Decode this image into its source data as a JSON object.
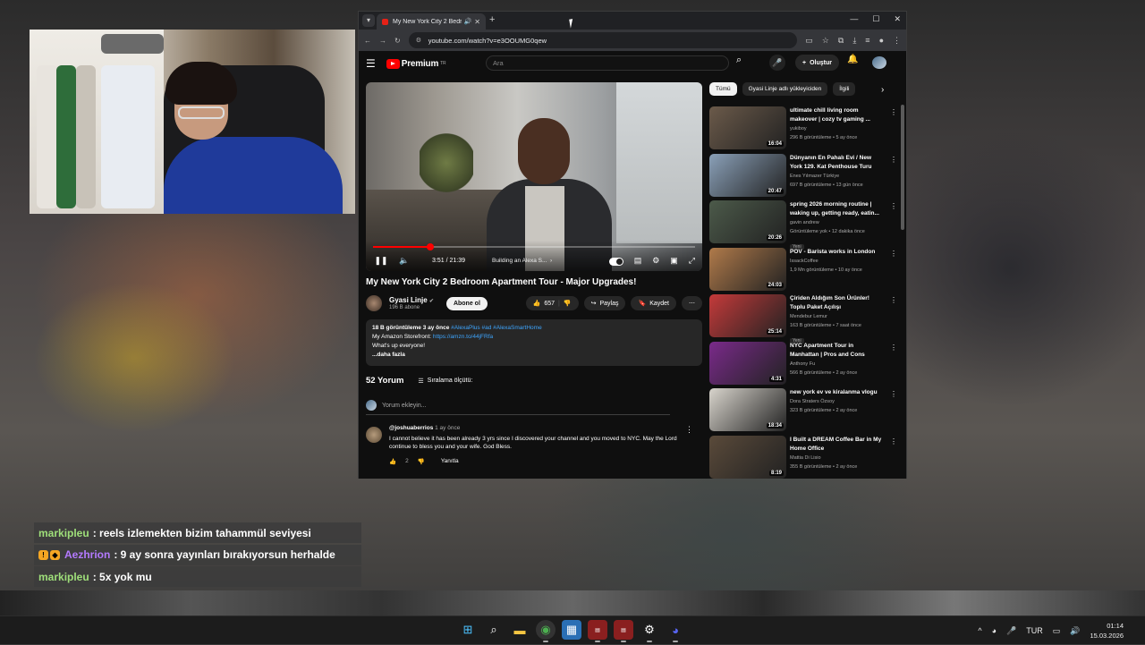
{
  "browser": {
    "tab_title": "My New York City 2 Bedroo",
    "url": "youtube.com/watch?v=e3OOUMG0qew"
  },
  "yt": {
    "search_placeholder": "Ara",
    "create_label": "Oluştur",
    "logo_text": "Premium",
    "logo_sup": "TR",
    "player": {
      "time": "3:51 / 21:39",
      "chapter": "Building an Alexa S...",
      "progress_fraction": 0.178
    },
    "video_title": "My New York City 2 Bedroom Apartment Tour - Major Upgrades!",
    "channel": {
      "name": "Gyasi Linje",
      "subs": "196 B abone"
    },
    "subscribe_label": "Abone ol",
    "likes": "657",
    "share_label": "Paylaş",
    "save_label": "Kaydet",
    "desc": {
      "meta": "18 B görüntüleme  3 ay önce",
      "tags": "#AlexaPlus #ad #AlexaSmartHome",
      "line1_prefix": "My Amazon Storefront: ",
      "line1_link": "https://amzn.to/44jFRfa",
      "line2": "What's up everyone!",
      "more": "...daha fazla"
    },
    "comments": {
      "count": "52 Yorum",
      "sort": "Sıralama ölçütü:",
      "add_placeholder": "Yorum ekleyin...",
      "first": {
        "author": "@joshuaberrios",
        "age": "1 ay önce",
        "text": "I cannot believe it has been already 3 yrs since I discovered your channel and you moved to NYC. May the Lord continue to bless you and your wife. God Bless.",
        "likes": "2",
        "reply": "Yanıtla"
      }
    },
    "chips": [
      "Tümü",
      "Gyasi Linje adlı yükleyiciden",
      "İlgili"
    ],
    "recs": [
      {
        "title": "ultimate chill living room makeover | cozy tv gaming ...",
        "channel": "yukiboy",
        "meta": "296 B görüntüleme • 5 ay önce",
        "dur": "16:04",
        "badge": "",
        "color": "#6b5a4a"
      },
      {
        "title": "Dünyanın En Pahalı Evi / New York 129. Kat Penthouse Turu",
        "channel": "Enes Yılmazer Türkiye",
        "meta": "697 B görüntüleme • 13 gün önce",
        "dur": "20:47",
        "badge": "",
        "color": "#8aa0b8"
      },
      {
        "title": "spring 2026 morning routine | waking up, getting ready, eatin...",
        "channel": "gavin andrew",
        "meta": "Görüntüleme yok • 12 dakika önce",
        "dur": "20:26",
        "badge": "Yeni",
        "color": "#4c5a4a"
      },
      {
        "title": "POV - Barista works in London",
        "channel": "IssackCoffee",
        "meta": "1,9 Mn görüntüleme • 10 ay önce",
        "dur": "24:03",
        "badge": "",
        "color": "#b07a4a"
      },
      {
        "title": "Çiriden Aldığım Son Ürünler! Toplu Paket Açılışı",
        "channel": "Mendebur Lemur",
        "meta": "163 B görüntüleme • 7 saat önce",
        "dur": "25:14",
        "badge": "Yeni",
        "color": "#c43a3a"
      },
      {
        "title": "NYC Apartment Tour in Manhattan | Pros and Cons",
        "channel": "Anthony Fu",
        "meta": "566 B görüntüleme • 2 ay önce",
        "dur": "4:31",
        "badge": "",
        "color": "#7a2a8a"
      },
      {
        "title": "new york ev ve kiralanma vlogu",
        "channel": "Dora Straters Özsoy",
        "meta": "323 B görüntüleme • 2 ay önce",
        "dur": "18:34",
        "badge": "",
        "color": "#d8d4cc"
      },
      {
        "title": "I Built a DREAM Coffee Bar in My Home Office",
        "channel": "Mattia Di Lisio",
        "meta": "355 B görüntüleme • 2 ay önce",
        "dur": "8:19",
        "badge": "",
        "color": "#5a4a3a"
      }
    ]
  },
  "chat": [
    {
      "user": "markipleu",
      "color": "#9fdf7a",
      "msg": ": reels izlemekten bizim tahammül seviyesi",
      "badges": false
    },
    {
      "user": "Aezhrion",
      "color": "#b47aff",
      "msg": ": 9 ay sonra yayınları bırakıyorsun herhalde",
      "badges": true
    },
    {
      "user": "markipleu",
      "color": "#9fdf7a",
      "msg": ": 5x yok mu",
      "badges": false
    }
  ],
  "taskbar": {
    "lang": "TUR",
    "time": "01:14",
    "date": "15.03.2026"
  }
}
